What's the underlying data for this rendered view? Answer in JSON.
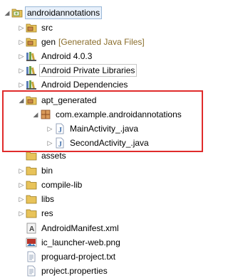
{
  "tree": {
    "project": "androidannotations",
    "items": [
      {
        "label": "src",
        "icon": "package-folder-icon"
      },
      {
        "label": "gen",
        "decoration": "[Generated Java Files]",
        "icon": "package-folder-icon"
      },
      {
        "label": "Android 4.0.3",
        "icon": "library-icon"
      },
      {
        "label": "Android Private Libraries",
        "icon": "library-icon"
      },
      {
        "label": "Android Dependencies",
        "icon": "library-icon"
      },
      {
        "label": "apt_generated",
        "icon": "package-folder-icon"
      },
      {
        "label": "com.example.androidannotations",
        "icon": "package-icon"
      },
      {
        "label": "MainActivity_.java",
        "icon": "java-file-icon"
      },
      {
        "label": "SecondActivity_.java",
        "icon": "java-file-icon"
      },
      {
        "label": "assets",
        "icon": "folder-icon"
      },
      {
        "label": "bin",
        "icon": "folder-icon"
      },
      {
        "label": "compile-lib",
        "icon": "folder-icon"
      },
      {
        "label": "libs",
        "icon": "folder-icon"
      },
      {
        "label": "res",
        "icon": "folder-icon"
      },
      {
        "label": "AndroidManifest.xml",
        "icon": "android-manifest-icon"
      },
      {
        "label": "ic_launcher-web.png",
        "icon": "image-file-icon"
      },
      {
        "label": "proguard-project.txt",
        "icon": "text-file-icon"
      },
      {
        "label": "project.properties",
        "icon": "text-file-icon"
      }
    ]
  },
  "highlight_color": "#e02b2b"
}
